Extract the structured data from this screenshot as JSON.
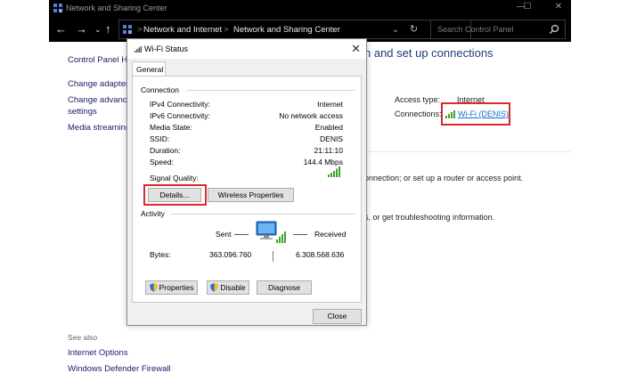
{
  "window": {
    "title": "Network and Sharing Center",
    "minimize": "—",
    "maximize": "☐",
    "close": "✕"
  },
  "address": {
    "back": "←",
    "forward": "→",
    "down": "⌄",
    "up": "↑",
    "crumbs": [
      "Network and Internet",
      "Network and Sharing Center"
    ],
    "separator": ">",
    "dropdown": "⌄",
    "refresh": "↻",
    "search_placeholder": "Search Control Panel"
  },
  "left_nav": {
    "home": "Control Panel Ho",
    "adapter": "Change adapter s",
    "advanced_1": "Change advanced",
    "advanced_2": "settings",
    "streaming": "Media streaming"
  },
  "main": {
    "heading": "n and set up connections",
    "access_type_label": "Access type:",
    "access_type_value": "Internet",
    "connections_label": "Connections:",
    "connection_link": "Wi-Fi (DENIS)",
    "line1": "onnection; or set up a router or access point.",
    "line2": "s, or get troubleshooting information."
  },
  "see_also": {
    "label": "See also",
    "links": [
      "Internet Options",
      "Windows Defender Firewall"
    ]
  },
  "dialog": {
    "title": "Wi-Fi Status",
    "close": "✕",
    "tab": "General",
    "connection_group": "Connection",
    "rows": [
      {
        "label": "IPv4 Connectivity:",
        "value": "Internet"
      },
      {
        "label": "IPv6 Connectivity:",
        "value": "No network access"
      },
      {
        "label": "Media State:",
        "value": "Enabled"
      },
      {
        "label": "SSID:",
        "value": "DENIS"
      },
      {
        "label": "Duration:",
        "value": "21:11:10"
      },
      {
        "label": "Speed:",
        "value": "144.4 Mbps"
      }
    ],
    "signal_label": "Signal Quality:",
    "details_button": "Details...",
    "wireless_button": "Wireless Properties",
    "activity_group": "Activity",
    "sent_label": "Sent",
    "received_label": "Received",
    "bytes_label": "Bytes:",
    "bytes_sent": "363.096.760",
    "bytes_received": "6.308.568.636",
    "properties_button": "Properties",
    "disable_button": "Disable",
    "diagnose_button": "Diagnose",
    "close_button": "Close"
  },
  "colors": {
    "highlight": "#d62b2b",
    "link": "#1a6fc4",
    "signal": "#3fa62a",
    "titlebar": "#000000"
  }
}
